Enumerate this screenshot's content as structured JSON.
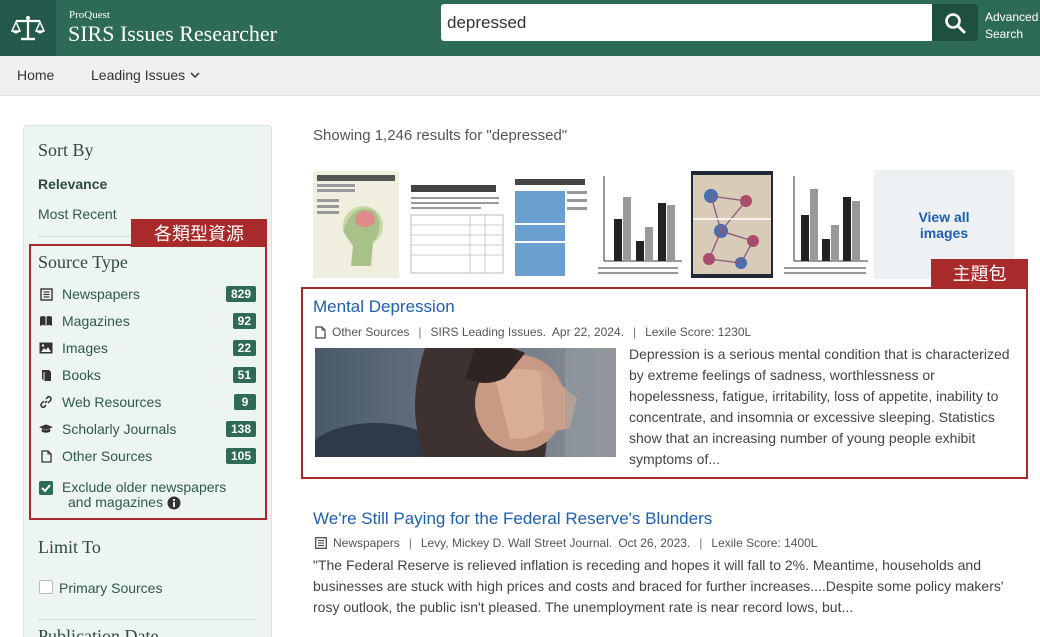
{
  "header": {
    "brand_small": "ProQuest",
    "brand_big": "SIRS Issues Researcher",
    "search_value": "depressed",
    "advanced_line1": "Advanced",
    "advanced_line2": "Search",
    "bg_color": "#2e6b56"
  },
  "nav": {
    "home": "Home",
    "leading_issues": "Leading Issues"
  },
  "sidebar": {
    "sort_by": "Sort By",
    "sort_relevance": "Relevance",
    "sort_recent": "Most Recent",
    "annotation_source": "各類型資源",
    "source_type": "Source Type",
    "sources": [
      {
        "label": "Newspapers",
        "count": "829",
        "icon": "newspaper-icon"
      },
      {
        "label": "Magazines",
        "count": "92",
        "icon": "magazine-icon"
      },
      {
        "label": "Images",
        "count": "22",
        "icon": "image-icon"
      },
      {
        "label": "Books",
        "count": "51",
        "icon": "book-icon"
      },
      {
        "label": "Web Resources",
        "count": "9",
        "icon": "link-icon"
      },
      {
        "label": "Scholarly Journals",
        "count": "138",
        "icon": "graduation-cap-icon"
      },
      {
        "label": "Other Sources",
        "count": "105",
        "icon": "document-icon"
      }
    ],
    "exclude_line1": "Exclude older newspapers",
    "exclude_line2": "and magazines",
    "exclude_checked": true,
    "limit_to": "Limit To",
    "primary_sources": "Primary Sources",
    "publication_date": "Publication Date"
  },
  "main": {
    "results_text": "Showing 1,246 results for \"depressed\"",
    "view_all_line1": "View all",
    "view_all_line2": "images",
    "annotation_topic": "主題包",
    "results": [
      {
        "title": "Mental Depression",
        "source_type": "Other Sources",
        "publisher": "SIRS Leading Issues.",
        "date": "Apr 22, 2024.",
        "lexile": "Lexile Score: 1230L",
        "snippet": "Depression is a serious mental condition that is characterized by extreme feelings of sadness, worthlessness or hopelessness, fatigue, irritability, loss of appetite, inability to concentrate, and insomnia or excessive sleeping. Statistics show that an increasing number of young people exhibit symptoms of..."
      },
      {
        "title": "We're Still Paying for the Federal Reserve's Blunders",
        "source_type": "Newspapers",
        "publisher": "Levy, Mickey D. Wall Street Journal.",
        "date": "Oct 26, 2023.",
        "lexile": "Lexile Score: 1400L",
        "snippet": "\"The Federal Reserve is relieved inflation is receding and hopes it will fall to 2%. Meantime, households and businesses are stuck with high prices and costs and braced for further increases....Despite some policy makers' rosy outlook, the public isn't pleased. The unemployment rate is near record lows, but..."
      }
    ]
  }
}
